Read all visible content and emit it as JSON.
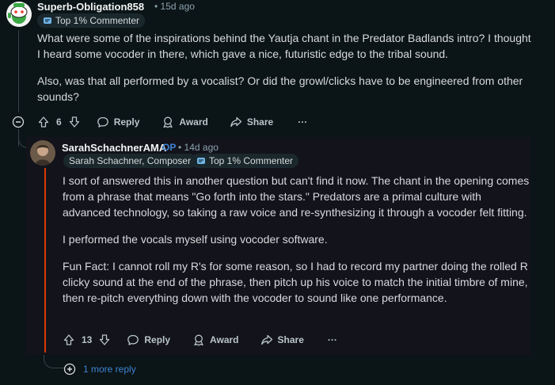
{
  "comment": {
    "username": "Superb-Obligation858",
    "time": "15d ago",
    "flair": "Top 1% Commenter",
    "paragraphs": [
      "What were some of the inspirations behind the Yautja chant in the Predator Badlands intro? I thought I heard some vocoder in there, which gave a nice, futuristic edge to the tribal sound.",
      "Also, was that all performed by a vocalist? Or did the growl/clicks have to be engineered from other sounds?"
    ],
    "votes": "6",
    "reply_label": "Reply",
    "award_label": "Award",
    "share_label": "Share",
    "more_label": "···"
  },
  "reply": {
    "username": "SarahSchachnerAMA",
    "op_label": "OP",
    "time": "14d ago",
    "flair1": "Sarah Schachner, Composer",
    "flair2": "Top 1% Commenter",
    "paragraphs": [
      "I sort of answered this in another question but can't find it now. The chant in the opening comes from a phrase that means \"Go forth into the stars.\" Predators are a primal culture with advanced technology, so taking a raw voice and re-synthesizing it through a vocoder felt fitting.",
      "I performed the vocals myself using vocoder software.",
      "Fun Fact: I cannot roll my R's for some reason, so I had to record my partner doing the rolled R clicky sound at the end of the phrase, then pitch up his voice to match the initial timbre of mine, then re-pitch everything down with the vocoder to sound like one performance."
    ],
    "votes": "13",
    "reply_label": "Reply",
    "award_label": "Award",
    "share_label": "Share",
    "more_label": "···"
  },
  "more_replies": "1 more reply",
  "colors": {
    "background": "#0b1416",
    "reply_card": "#13131b",
    "accent_blue": "#3d84d4",
    "orange_line": "#d93a00",
    "thread_line": "#33464c"
  }
}
